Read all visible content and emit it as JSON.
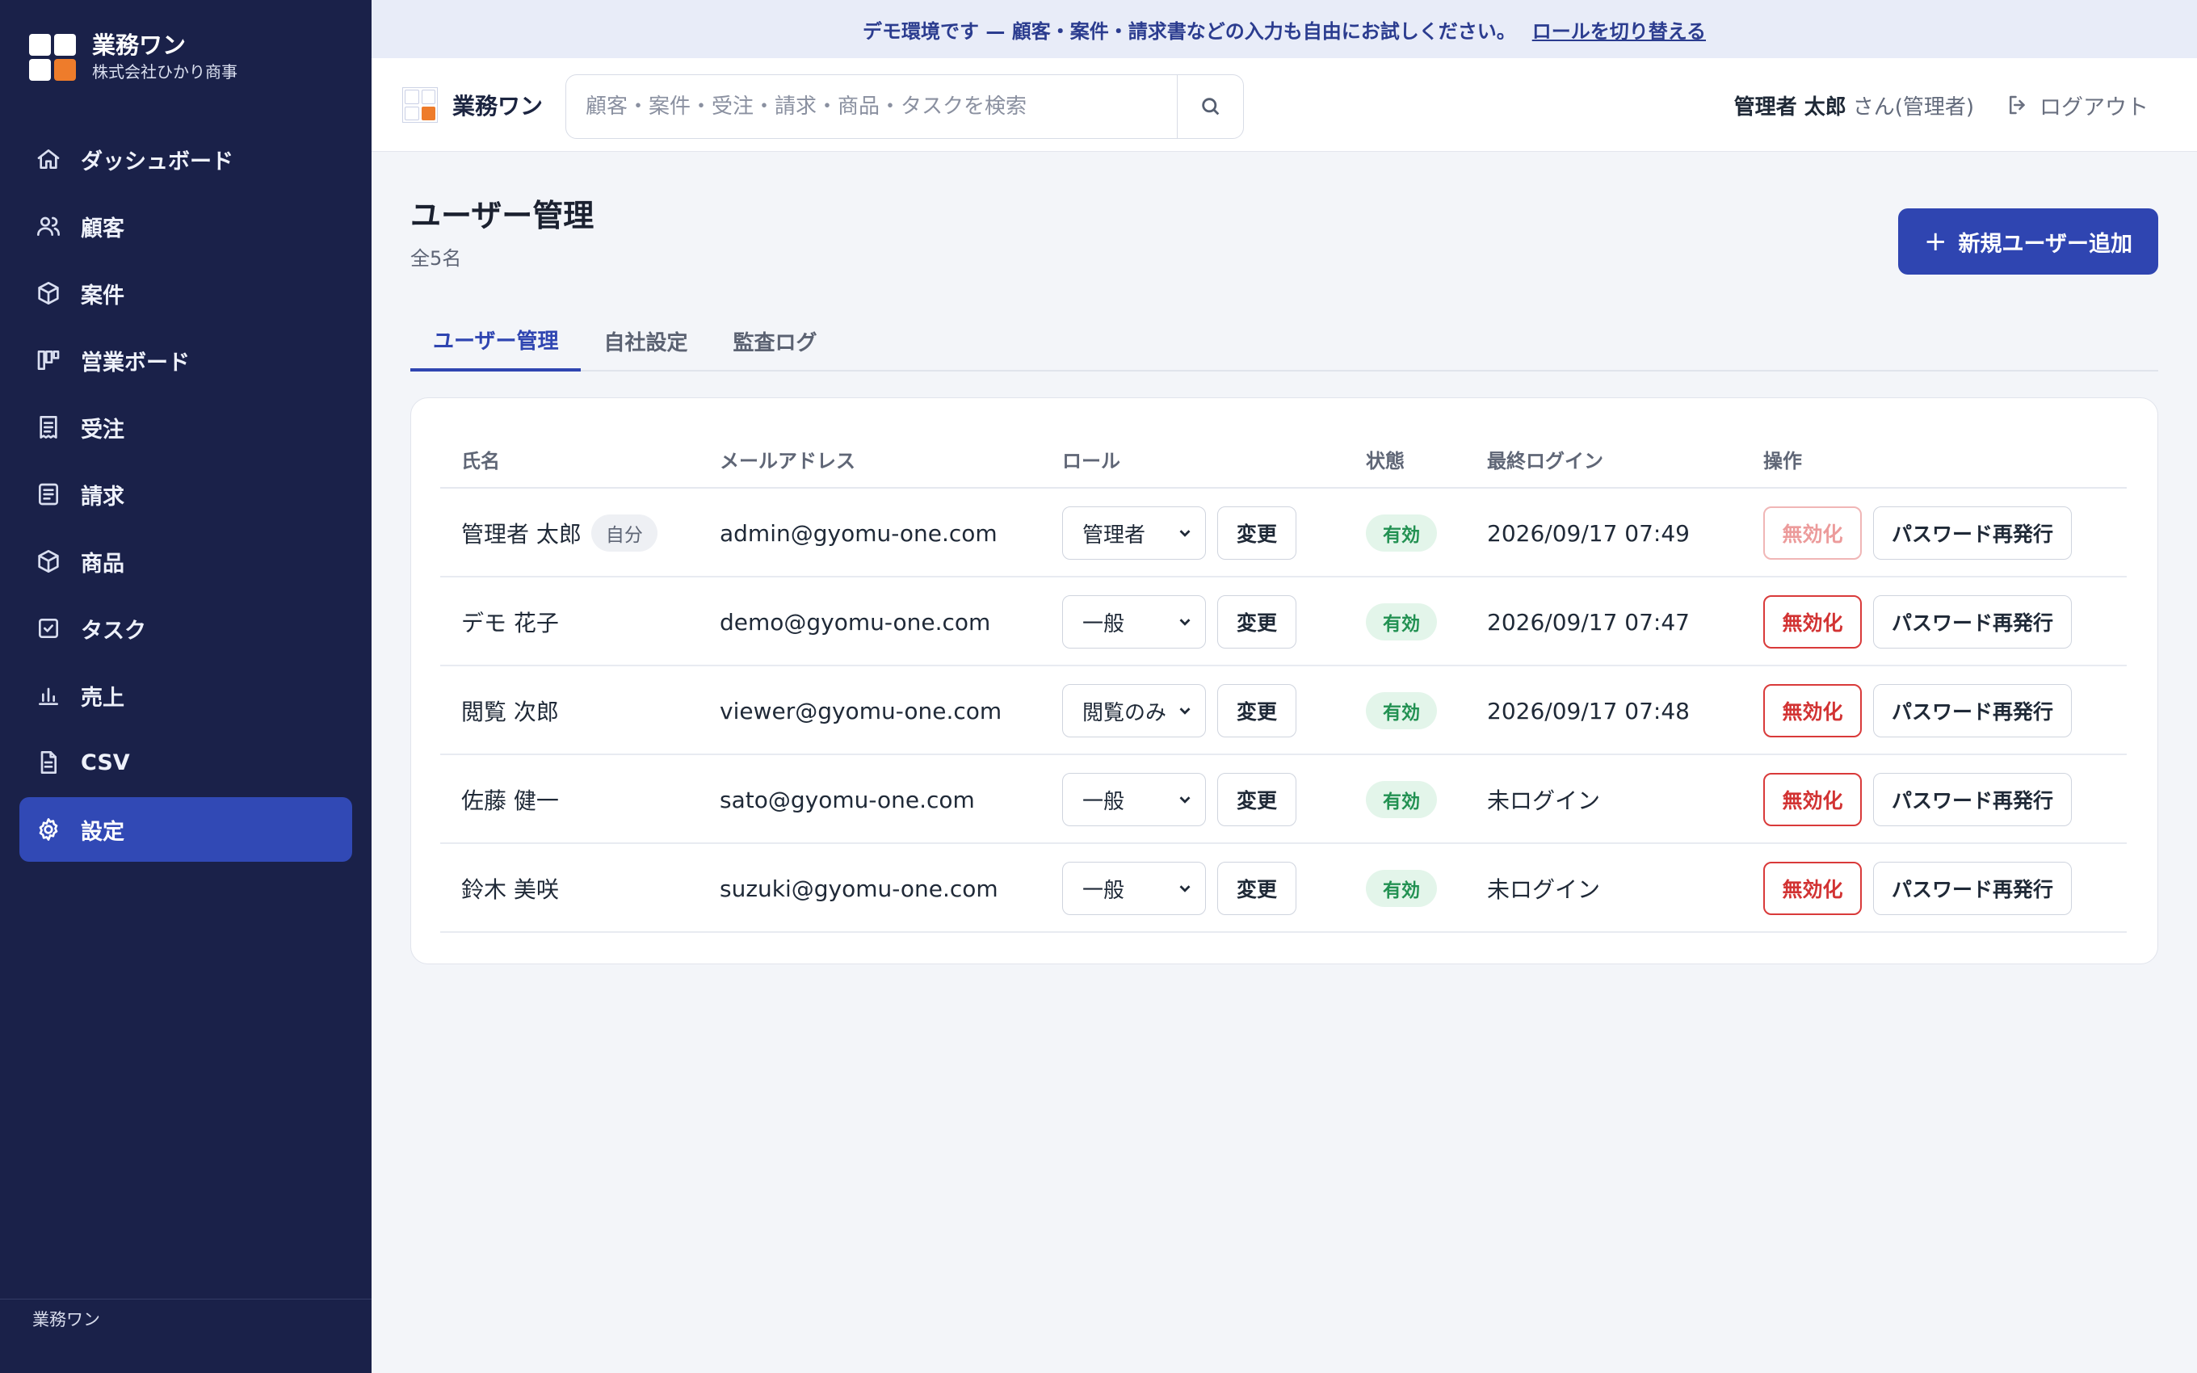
{
  "sidebar": {
    "brand_name": "業務ワン",
    "company": "株式会社ひかり商事",
    "items": [
      {
        "label": "ダッシュボード",
        "icon": "home-icon"
      },
      {
        "label": "顧客",
        "icon": "users-icon"
      },
      {
        "label": "案件",
        "icon": "box-icon"
      },
      {
        "label": "営業ボード",
        "icon": "kanban-icon"
      },
      {
        "label": "受注",
        "icon": "receipt-icon"
      },
      {
        "label": "請求",
        "icon": "invoice-icon"
      },
      {
        "label": "商品",
        "icon": "package-icon"
      },
      {
        "label": "タスク",
        "icon": "checkbox-icon"
      },
      {
        "label": "売上",
        "icon": "bar-chart-icon"
      },
      {
        "label": "CSV",
        "icon": "file-icon"
      },
      {
        "label": "設定",
        "icon": "gear-icon",
        "active": true
      }
    ],
    "footer": "業務ワン"
  },
  "banner": {
    "text": "デモ環境です — 顧客・案件・請求書などの入力も自由にお試しください。",
    "link": "ロールを切り替える"
  },
  "header": {
    "logo_text": "業務ワン",
    "search_placeholder": "顧客・案件・受注・請求・商品・タスクを検索",
    "user_name": "管理者 太郎",
    "user_suffix": "さん(管理者)",
    "logout": "ログアウト"
  },
  "page": {
    "title": "ユーザー管理",
    "count": "全5名",
    "add_button": "新規ユーザー追加"
  },
  "tabs": [
    "ユーザー管理",
    "自社設定",
    "監査ログ"
  ],
  "table": {
    "headers": {
      "name": "氏名",
      "email": "メールアドレス",
      "role": "ロール",
      "status": "状態",
      "last_login": "最終ログイン",
      "actions": "操作"
    },
    "change_label": "変更",
    "disable_label": "無効化",
    "reset_label": "パスワード再発行",
    "self_badge": "自分",
    "rows": [
      {
        "name": "管理者 太郎",
        "email": "admin@gyomu-one.com",
        "role": "管理者",
        "status": "有効",
        "last_login": "2026/09/17 07:49",
        "self": true
      },
      {
        "name": "デモ 花子",
        "email": "demo@gyomu-one.com",
        "role": "一般",
        "status": "有効",
        "last_login": "2026/09/17 07:47"
      },
      {
        "name": "閲覧 次郎",
        "email": "viewer@gyomu-one.com",
        "role": "閲覧のみ",
        "status": "有効",
        "last_login": "2026/09/17 07:48"
      },
      {
        "name": "佐藤 健一",
        "email": "sato@gyomu-one.com",
        "role": "一般",
        "status": "有効",
        "last_login": "未ログイン"
      },
      {
        "name": "鈴木 美咲",
        "email": "suzuki@gyomu-one.com",
        "role": "一般",
        "status": "有効",
        "last_login": "未ログイン"
      }
    ]
  },
  "colors": {
    "sidebar_bg": "#1a2149",
    "accent": "#2f45b1",
    "danger": "#d93a3a",
    "success": "#229152",
    "logo_orange": "#ee7c2b"
  }
}
